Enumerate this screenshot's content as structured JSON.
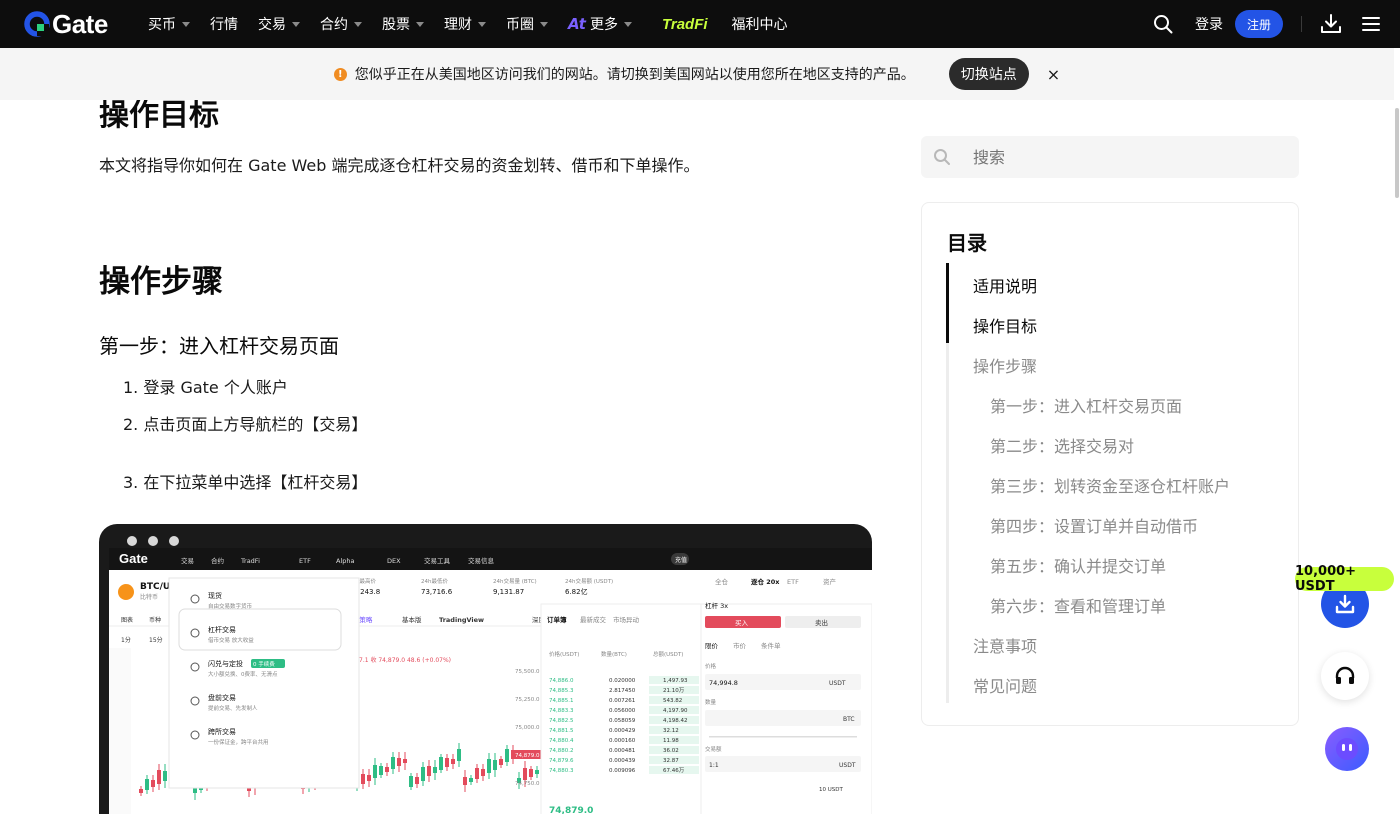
{
  "nav": {
    "logo_text": "Gate",
    "items": [
      {
        "label": "买币",
        "has_caret": true
      },
      {
        "label": "行情",
        "has_caret": false
      },
      {
        "label": "交易",
        "has_caret": true
      },
      {
        "label": "合约",
        "has_caret": true
      },
      {
        "label": "股票",
        "has_caret": true
      },
      {
        "label": "理财",
        "has_caret": true
      },
      {
        "label": "币圈",
        "has_caret": true
      },
      {
        "label": "更多",
        "has_caret": true
      },
      {
        "label": "TradFi",
        "has_caret": false
      },
      {
        "label": "福利中心",
        "has_caret": false
      }
    ],
    "ai_icon": "At",
    "login": "登录",
    "register": "注册"
  },
  "banner": {
    "text": "您似乎正在从美国地区访问我们的网站。请切换到美国网站以使用您所在地区支持的产品。",
    "switch_label": "切换站点",
    "close": "×"
  },
  "article": {
    "cut_heading": "操作目标",
    "intro": "本文将指导你如何在 Gate Web 端完成逐仓杠杆交易的资金划转、借币和下单操作。",
    "section_heading": "操作步骤",
    "step_heading": "第一步：进入杠杆交易页面",
    "steps": [
      "1. 登录 Gate 个人账户",
      "2. 点击页面上方导航栏的【交易】",
      "3. 在下拉菜单中选择【杠杆交易】"
    ]
  },
  "sidebar": {
    "search_placeholder": "搜索",
    "toc_title": "目录",
    "toc": [
      {
        "label": "适用说明",
        "level": 1,
        "active": true
      },
      {
        "label": "操作目标",
        "level": 1,
        "active": true
      },
      {
        "label": "操作步骤",
        "level": 1,
        "active": false
      },
      {
        "label": "第一步：进入杠杆交易页面",
        "level": 2,
        "active": false
      },
      {
        "label": "第二步：选择交易对",
        "level": 2,
        "active": false
      },
      {
        "label": "第三步：划转资金至逐仓杠杆账户",
        "level": 2,
        "active": false
      },
      {
        "label": "第四步：设置订单并自动借币",
        "level": 2,
        "active": false
      },
      {
        "label": "第五步：确认并提交订单",
        "level": 2,
        "active": false
      },
      {
        "label": "第六步：查看和管理订单",
        "level": 2,
        "active": false
      },
      {
        "label": "注意事项",
        "level": 1,
        "active": false
      },
      {
        "label": "常见问题",
        "level": 1,
        "active": false
      }
    ]
  },
  "floating": {
    "promo": "10,000+ USDT"
  },
  "screenshot": {
    "nav_items": [
      "交易",
      "合约",
      "TradFi",
      "ETF",
      "Alpha",
      "DEX",
      "交易工具",
      "交易信息"
    ],
    "pair": "BTC/USDT",
    "pair_sub": "比特币",
    "stats": [
      {
        "label": "24h最高价",
        "value": "75,243.8"
      },
      {
        "label": "24h最低价",
        "value": "73,716.6"
      },
      {
        "label": "24h交易量 (BTC)",
        "value": "9,131.87"
      },
      {
        "label": "24h交易额 (USDT)",
        "value": "6.82亿"
      }
    ],
    "chart_tabs": [
      "AI 策略",
      "基本版",
      "TradingView",
      "深度图"
    ],
    "interval": "15分",
    "price_line": "7.1  收 74,879.0 48.6 (+0.07%)",
    "dropdown": [
      {
        "title": "现货",
        "sub": "自由交易数字货币",
        "badge": ""
      },
      {
        "title": "杠杆交易",
        "sub": "借币交易 放大收益",
        "badge": ""
      },
      {
        "title": "闪兑与定投",
        "sub": "大小额兑换、0费率、无滑点",
        "badge": "0 手续费"
      },
      {
        "title": "盘前交易",
        "sub": "提前交易、先发制人",
        "badge": ""
      },
      {
        "title": "跨所交易",
        "sub": "一份保证金，跨平台共用",
        "badge": ""
      }
    ],
    "orderbook_tabs": [
      "订单簿",
      "最新成交",
      "市场异动"
    ],
    "orderbook_head": [
      "价格(USDT)",
      "数量(BTC)",
      "总额(USDT)"
    ],
    "asks": [
      [
        "74,886.0",
        "0.020000",
        "1,497.93"
      ],
      [
        "74,885.3",
        "2.817450",
        "21.10万"
      ],
      [
        "74,885.1",
        "0.007261",
        "543.82"
      ],
      [
        "74,883.3",
        "0.056000",
        "4,197.90"
      ],
      [
        "74,882.5",
        "0.058059",
        "4,198.42"
      ],
      [
        "74,881.5",
        "0.000429",
        "32.12"
      ],
      [
        "74,880.4",
        "0.000160",
        "11.98"
      ],
      [
        "74,880.2",
        "0.000481",
        "36.02"
      ],
      [
        "74,879.6",
        "0.000439",
        "32.87"
      ],
      [
        "74,880.3",
        "0.009096",
        "67.46万"
      ]
    ],
    "last_price": "74,879.0",
    "axis_prices": [
      "75,500.0",
      "75,250.0",
      "75,000.0",
      "74,879.0",
      "74,750.0"
    ],
    "trade_panel": {
      "tabs": [
        "全仓",
        "逐仓 20x",
        "ETF",
        "资产"
      ],
      "leverage": "杠杆 3x",
      "buy": "买入",
      "sell": "卖出",
      "order_tabs": [
        "限价",
        "市价",
        "条件单"
      ],
      "price_label": "价格",
      "price_value": "74,994.8",
      "price_unit": "USDT",
      "qty_label": "数量",
      "qty_unit": "BTC",
      "total_label": "交易额",
      "total_unit": "USDT",
      "avail": "10 USDT",
      "ratio": "1:1"
    },
    "top_right_button": "充值"
  }
}
